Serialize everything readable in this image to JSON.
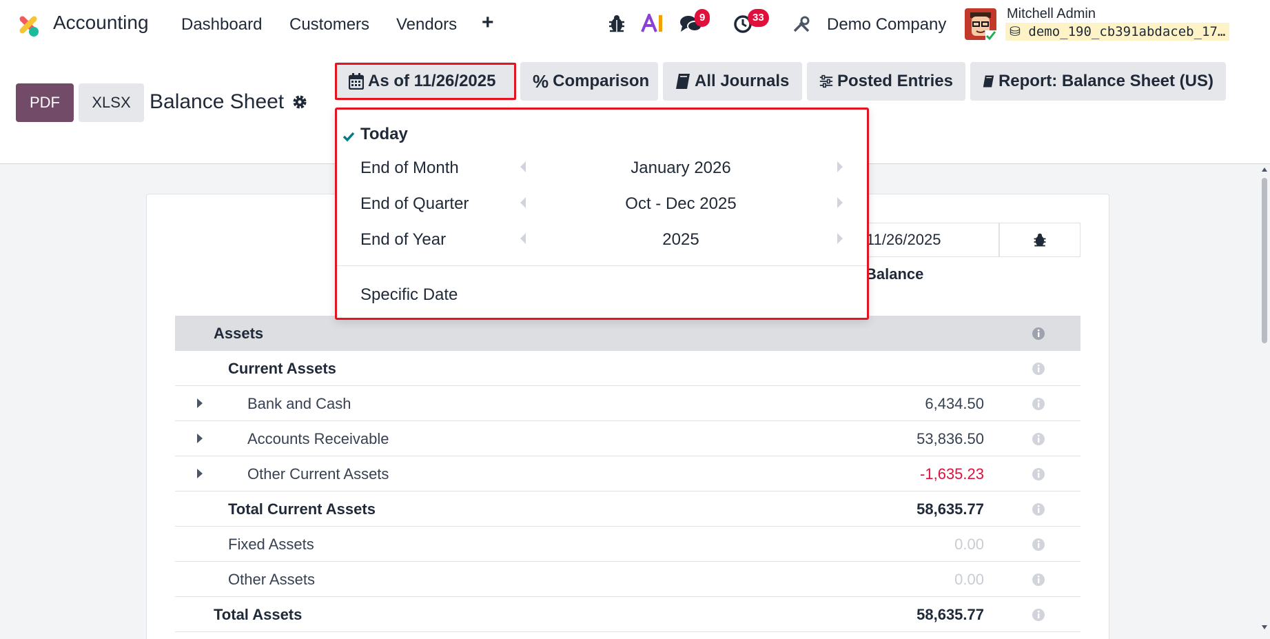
{
  "nav": {
    "app_name": "Accounting",
    "items": [
      "Dashboard",
      "Customers",
      "Vendors"
    ],
    "messages_count": "9",
    "activities_count": "33",
    "company": "Demo Company",
    "user_name": "Mitchell Admin",
    "db_name": "demo_190_cb391abdaceb_17…"
  },
  "control": {
    "pdf_label": "PDF",
    "xlsx_label": "XLSX",
    "title": "Balance Sheet",
    "filters": {
      "date": "As of 11/26/2025",
      "comparison": "Comparison",
      "journals": "All Journals",
      "entries": "Posted Entries",
      "report": "Report: Balance Sheet (US)"
    }
  },
  "dropdown": {
    "today": "Today",
    "end_of_month": "End of Month",
    "end_of_quarter": "End of Quarter",
    "end_of_year": "End of Year",
    "month_value": "January 2026",
    "quarter_value": "Oct - Dec 2025",
    "year_value": "2025",
    "specific_date": "Specific Date"
  },
  "report": {
    "col_date": "11/26/2025",
    "col_balance": "Balance",
    "rows": {
      "assets": {
        "label": "Assets",
        "value": ""
      },
      "current_assets": {
        "label": "Current Assets",
        "value": ""
      },
      "bank_cash": {
        "label": "Bank and Cash",
        "value": "6,434.50"
      },
      "receivable": {
        "label": "Accounts Receivable",
        "value": "53,836.50"
      },
      "other_current": {
        "label": "Other Current Assets",
        "value": "-1,635.23"
      },
      "total_current": {
        "label": "Total Current Assets",
        "value": "58,635.77"
      },
      "fixed": {
        "label": "Fixed Assets",
        "value": "0.00"
      },
      "other_assets": {
        "label": "Other Assets",
        "value": "0.00"
      },
      "total_assets": {
        "label": "Total Assets",
        "value": "58,635.77"
      }
    }
  },
  "colors": {
    "brand": "#714b67",
    "badge": "#e0103d",
    "highlight": "#e3141f",
    "negative": "#e0103d",
    "check": "#017e84"
  }
}
